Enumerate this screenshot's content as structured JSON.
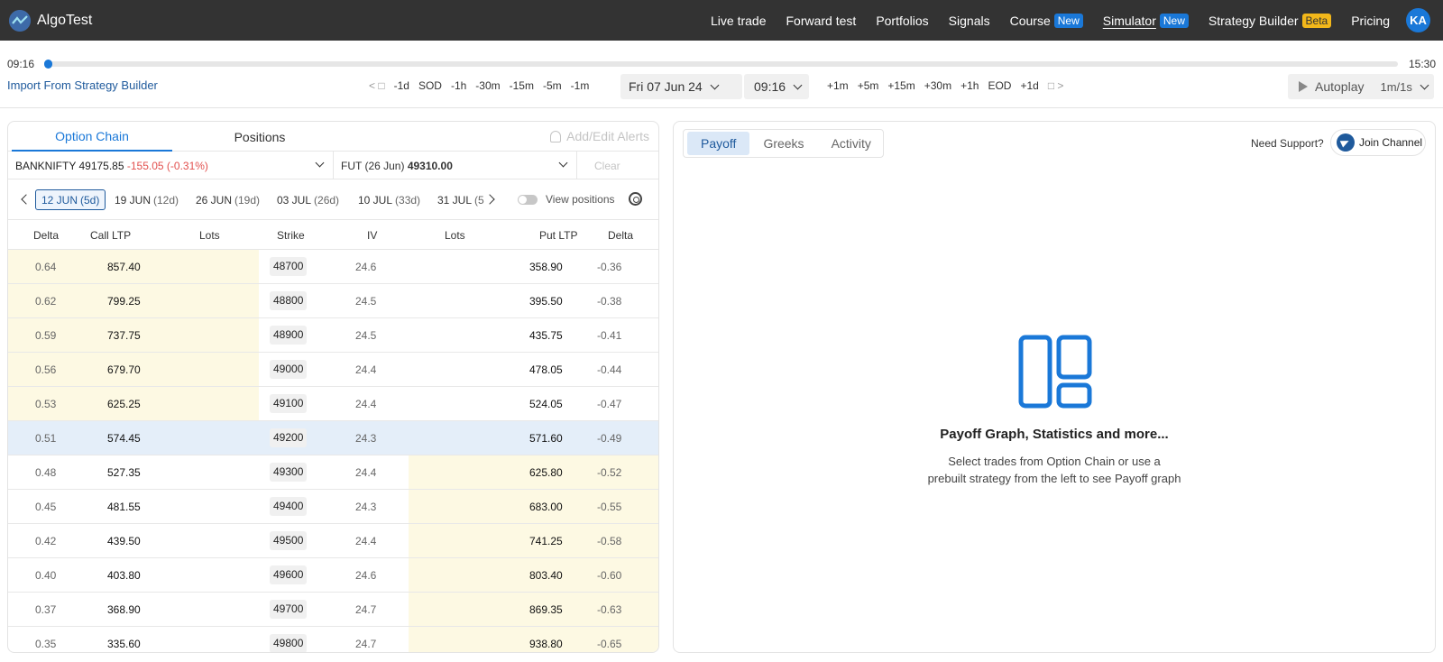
{
  "nav": {
    "brand": "AlgoTest",
    "items": [
      {
        "label": "Live trade",
        "badge": ""
      },
      {
        "label": "Forward test",
        "badge": ""
      },
      {
        "label": "Portfolios",
        "badge": ""
      },
      {
        "label": "Signals",
        "badge": ""
      },
      {
        "label": "Course",
        "badge": "New"
      },
      {
        "label": "Simulator",
        "badge": "New"
      },
      {
        "label": "Strategy Builder",
        "badge": "Beta"
      },
      {
        "label": "Pricing",
        "badge": ""
      }
    ],
    "avatar": "KA"
  },
  "timeline": {
    "start": "09:16",
    "end": "15:30",
    "progress": 0,
    "import_label": "Import From Strategy Builder",
    "back_steps": [
      "-1d",
      "SOD",
      "-1h",
      "-30m",
      "-15m",
      "-5m",
      "-1m"
    ],
    "date": "Fri  07 Jun 24",
    "time": "09:16",
    "fwd_steps": [
      "+1m",
      "+5m",
      "+15m",
      "+30m",
      "+1h",
      "EOD",
      "+1d"
    ],
    "autoplay_label": "Autoplay",
    "speed": "1m/1s"
  },
  "left": {
    "tabs": [
      "Option Chain",
      "Positions"
    ],
    "alerts_label": "Add/Edit Alerts",
    "symbol_name": "BANKNIFTY",
    "symbol_price": "49175.85",
    "symbol_change": "-155.05 (-0.31%)",
    "fut_label": "FUT (26 Jun)",
    "fut_price": "49310.00",
    "clear_label": "Clear",
    "expiries": [
      {
        "date": "12 JUN",
        "days": "(5d)"
      },
      {
        "date": "19 JUN",
        "days": "(12d)"
      },
      {
        "date": "26 JUN",
        "days": "(19d)"
      },
      {
        "date": "03 JUL",
        "days": "(26d)"
      },
      {
        "date": "10 JUL",
        "days": "(33d)"
      },
      {
        "date": "31 JUL",
        "days": "(5"
      }
    ],
    "view_positions": "View positions",
    "headers": [
      "Delta",
      "Call LTP",
      "Lots",
      "Strike",
      "IV",
      "Lots",
      "Put LTP",
      "Delta"
    ],
    "rows": [
      {
        "cd": "0.64",
        "cl": "857.40",
        "strike": "48700",
        "iv": "24.6",
        "pl": "358.90",
        "pd": "-0.36",
        "itm": "call"
      },
      {
        "cd": "0.62",
        "cl": "799.25",
        "strike": "48800",
        "iv": "24.5",
        "pl": "395.50",
        "pd": "-0.38",
        "itm": "call"
      },
      {
        "cd": "0.59",
        "cl": "737.75",
        "strike": "48900",
        "iv": "24.5",
        "pl": "435.75",
        "pd": "-0.41",
        "itm": "call"
      },
      {
        "cd": "0.56",
        "cl": "679.70",
        "strike": "49000",
        "iv": "24.4",
        "pl": "478.05",
        "pd": "-0.44",
        "itm": "call"
      },
      {
        "cd": "0.53",
        "cl": "625.25",
        "strike": "49100",
        "iv": "24.4",
        "pl": "524.05",
        "pd": "-0.47",
        "itm": "call"
      },
      {
        "cd": "0.51",
        "cl": "574.45",
        "strike": "49200",
        "iv": "24.3",
        "pl": "571.60",
        "pd": "-0.49",
        "itm": "atm"
      },
      {
        "cd": "0.48",
        "cl": "527.35",
        "strike": "49300",
        "iv": "24.4",
        "pl": "625.80",
        "pd": "-0.52",
        "itm": "put"
      },
      {
        "cd": "0.45",
        "cl": "481.55",
        "strike": "49400",
        "iv": "24.3",
        "pl": "683.00",
        "pd": "-0.55",
        "itm": "put"
      },
      {
        "cd": "0.42",
        "cl": "439.50",
        "strike": "49500",
        "iv": "24.4",
        "pl": "741.25",
        "pd": "-0.58",
        "itm": "put"
      },
      {
        "cd": "0.40",
        "cl": "403.80",
        "strike": "49600",
        "iv": "24.6",
        "pl": "803.40",
        "pd": "-0.60",
        "itm": "put"
      },
      {
        "cd": "0.37",
        "cl": "368.90",
        "strike": "49700",
        "iv": "24.7",
        "pl": "869.35",
        "pd": "-0.63",
        "itm": "put"
      },
      {
        "cd": "0.35",
        "cl": "335.60",
        "strike": "49800",
        "iv": "24.7",
        "pl": "938.80",
        "pd": "-0.65",
        "itm": "put"
      }
    ]
  },
  "right": {
    "tabs": [
      "Payoff",
      "Greeks",
      "Activity"
    ],
    "support_label": "Need Support?",
    "join_label": "Join Channel",
    "empty_title": "Payoff Graph, Statistics and more...",
    "empty_line1": "Select trades from Option Chain or use a",
    "empty_line2": "prebuilt strategy from the left to see Payoff graph"
  },
  "colors": {
    "accent": "#1a78d8",
    "itm_bg": "#fdf9e3",
    "atm_bg": "#e4eef9",
    "negative": "#e2514f"
  }
}
